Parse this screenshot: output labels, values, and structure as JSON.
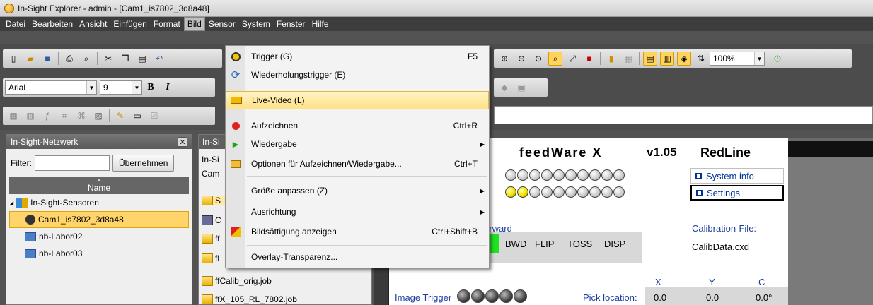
{
  "window": {
    "title": "In-Sight Explorer - admin - [Cam1_is7802_3d8a48]"
  },
  "menubar": [
    "Datei",
    "Bearbeiten",
    "Ansicht",
    "Einfügen",
    "Format",
    "Bild",
    "Sensor",
    "System",
    "Fenster",
    "Hilfe"
  ],
  "font_toolbar": {
    "font": "Arial",
    "size": "9"
  },
  "zoom": "100%",
  "network_panel": {
    "title": "In-Sight-Netzwerk",
    "filter_label": "Filter:",
    "apply_button": "Übernehmen",
    "column_header": "Name",
    "tree": [
      {
        "label": "In-Sight-Sensoren",
        "level": 0
      },
      {
        "label": "Cam1_is7802_3d8a48",
        "level": 1,
        "selected": true
      },
      {
        "label": "nb-Labor02",
        "level": 1
      },
      {
        "label": "nb-Labor03",
        "level": 1
      }
    ]
  },
  "file_panel": {
    "tab": "In-Si",
    "row1": "In-Si",
    "row2": "Cam",
    "files": [
      "S",
      "C",
      "ff",
      "fl",
      "ffCalib_orig.job",
      "ffX_105_RL_7802.job"
    ]
  },
  "image": {
    "title": "feedWare X",
    "version": "v1.05",
    "edition": "RedLine",
    "led_rows": [
      {
        "count": 10,
        "on": 0
      },
      {
        "count": 10,
        "on": 2
      }
    ],
    "links": [
      "System info",
      "Settings"
    ],
    "label_forward": "l forward",
    "status_labels": [
      "BWD",
      "FLIP",
      "TOSS",
      "DISP"
    ],
    "calib_label": "Calibration-File:",
    "calib_file": "CalibData.cxd",
    "columns": [
      "X",
      "Y",
      "C"
    ],
    "trigger_label": "Image Trigger",
    "trigger_leds": 5,
    "pick_label": "Pick location:",
    "pick_values": [
      "0.0",
      "0.0",
      "0.0°"
    ]
  },
  "dropdown": {
    "items": [
      {
        "label": "Trigger (G)",
        "shortcut": "F5",
        "icon": "trigger-icon"
      },
      {
        "label": "Wiederholungstrigger (E)",
        "shortcut": "",
        "icon": "repeat-trigger-icon"
      },
      {
        "label": "Live-Video (L)",
        "shortcut": "",
        "icon": "live-video-icon",
        "highlighted": true
      },
      {
        "label": "Aufzeichnen",
        "shortcut": "Ctrl+R",
        "icon": "record-icon"
      },
      {
        "label": "Wiedergabe",
        "shortcut": "",
        "icon": "play-icon",
        "submenu": true
      },
      {
        "label": "Optionen für Aufzeichnen/Wiedergabe...",
        "shortcut": "Ctrl+T",
        "icon": "folder-options-icon"
      },
      {
        "label": "Größe anpassen (Z)",
        "shortcut": "",
        "icon": "",
        "submenu": true
      },
      {
        "label": "Ausrichtung",
        "shortcut": "",
        "icon": "",
        "submenu": true
      },
      {
        "label": "Bildsättigung anzeigen",
        "shortcut": "Ctrl+Shift+B",
        "icon": "saturation-icon"
      },
      {
        "label": "Overlay-Transparenz...",
        "shortcut": "",
        "icon": ""
      }
    ]
  }
}
